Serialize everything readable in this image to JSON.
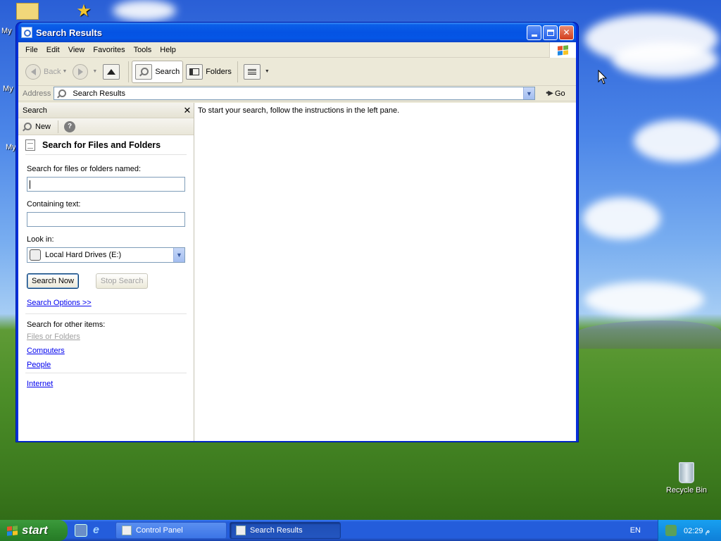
{
  "desktop": {
    "icons": [
      {
        "label": "My"
      },
      {
        "label": "My"
      },
      {
        "label": "My"
      },
      {
        "label": "Recycle Bin"
      }
    ]
  },
  "window": {
    "title": "Search Results",
    "menu": [
      "File",
      "Edit",
      "View",
      "Favorites",
      "Tools",
      "Help"
    ],
    "toolbar": {
      "back_label": "Back",
      "search_label": "Search",
      "folders_label": "Folders"
    },
    "address": {
      "label": "Address",
      "value": "Search Results",
      "go_label": "Go"
    },
    "search_pane": {
      "header": "Search",
      "new_label": "New",
      "help_glyph": "?",
      "section_title": "Search for Files and Folders",
      "named_label": "Search for files or folders named:",
      "named_value": "",
      "containing_label": "Containing text:",
      "containing_value": "",
      "lookin_label": "Look in:",
      "lookin_value": "Local Hard Drives (E:)",
      "search_now_label": "Search Now",
      "stop_search_label": "Stop Search",
      "options_link": "Search Options  >>",
      "other_items_label": "Search for other items:",
      "other_items": [
        "Files or Folders",
        "Computers",
        "People"
      ],
      "internet_link": "Internet"
    },
    "results_message": "To start your search, follow the instructions in the left pane."
  },
  "taskbar": {
    "start_label": "start",
    "tasks": [
      {
        "label": "Control Panel"
      },
      {
        "label": "Search Results"
      }
    ],
    "language": "EN",
    "clock": "02:29 م"
  },
  "colors": {
    "title_bar": "#0553e3",
    "window_border": "#0831d9",
    "taskbar": "#245ddb",
    "start_button": "#2f8a2f",
    "tray": "#0f7fd8",
    "link": "#0000ee"
  }
}
